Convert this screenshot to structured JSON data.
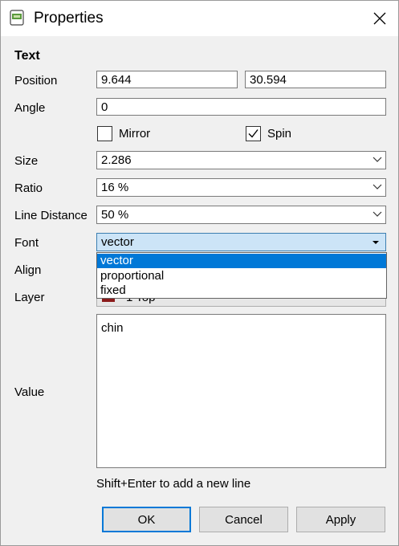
{
  "window": {
    "title": "Properties",
    "icons": {
      "app": "pcb-chip-icon",
      "close": "close-icon"
    }
  },
  "section_title": "Text",
  "labels": {
    "position": "Position",
    "angle": "Angle",
    "size": "Size",
    "ratio": "Ratio",
    "line_distance": "Line Distance",
    "font": "Font",
    "align": "Align",
    "layer": "Layer",
    "value": "Value"
  },
  "position": {
    "x": "9.644",
    "y": "30.594"
  },
  "angle": "0",
  "mirror": {
    "label": "Mirror",
    "checked": false
  },
  "spin": {
    "label": "Spin",
    "checked": true
  },
  "size": "2.286",
  "ratio": "16 %",
  "line_distance": "50 %",
  "font": {
    "value": "vector",
    "options": [
      "vector",
      "proportional",
      "fixed"
    ],
    "selected_index": 0
  },
  "layer": {
    "text": "1 Top",
    "color": "#8b1a1a"
  },
  "value_text": "chin",
  "hint": "Shift+Enter to add a new line",
  "buttons": {
    "ok": "OK",
    "cancel": "Cancel",
    "apply": "Apply"
  },
  "colors": {
    "accent": "#0078d7",
    "selection": "#cce4f7"
  }
}
